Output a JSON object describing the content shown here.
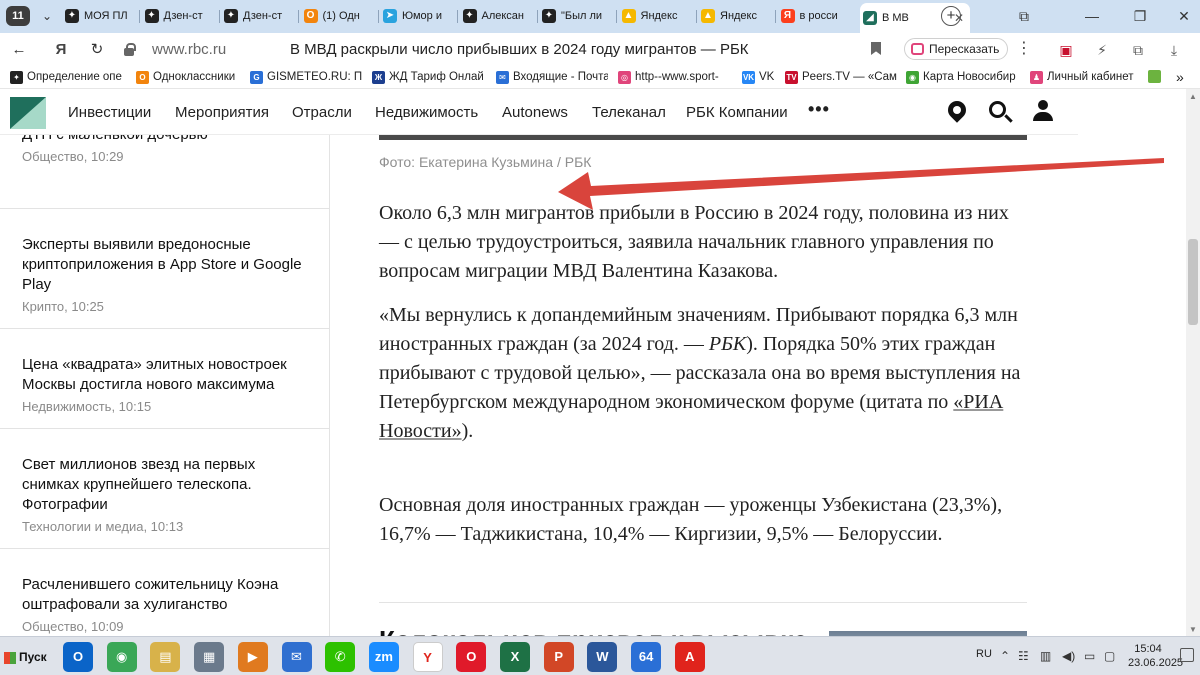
{
  "browser": {
    "tab_count": "11",
    "tabs": [
      {
        "label": "МОЯ ПЛ",
        "icon": "dzen-icon",
        "color": "#222222"
      },
      {
        "label": "Дзен-ст",
        "icon": "dzen-icon",
        "color": "#222222"
      },
      {
        "label": "Дзен-ст",
        "icon": "dzen-icon",
        "color": "#222222"
      },
      {
        "label": "(1) Одн",
        "icon": "odnoklassniki-icon",
        "color": "#f2840d"
      },
      {
        "label": "Юмор и",
        "icon": "telegram-icon",
        "color": "#2aa3de"
      },
      {
        "label": "Алексан",
        "icon": "dzen-icon",
        "color": "#222222"
      },
      {
        "label": "\"Был ли",
        "icon": "dzen-icon",
        "color": "#222222"
      },
      {
        "label": "Яндекс",
        "icon": "yandex-images-icon",
        "color": "#f5b800"
      },
      {
        "label": "Яндекс",
        "icon": "yandex-images-icon",
        "color": "#f5b800"
      },
      {
        "label": "в росси",
        "icon": "yandex-icon",
        "color": "#fc3f1d"
      },
      {
        "label": "В МВ",
        "icon": "rbc-icon",
        "color": "#1f6f5c",
        "active": true
      }
    ],
    "address": {
      "domain": "www.rbc.ru",
      "page_title": "В МВД раскрыли число прибывших в 2024 году мигрантов — РБК"
    },
    "retell_label": "Пересказать",
    "bookmarks": [
      {
        "label": "Определение опе",
        "icon": "dzen-icon",
        "color": "#222222"
      },
      {
        "label": "Одноклассники",
        "icon": "odnoklassniki-icon",
        "color": "#f2840d"
      },
      {
        "label": "GISMETEO.RU: По",
        "icon": "gismeteo-icon",
        "color": "#2a6fd6"
      },
      {
        "label": "ЖД Тариф Онлай",
        "icon": "rzd-icon",
        "color": "#1d3f8f"
      },
      {
        "label": "Входящие - Почта",
        "icon": "mail-icon",
        "color": "#2a6fd6"
      },
      {
        "label": "http--www.sport-",
        "icon": "sport-icon",
        "color": "#e0457b"
      },
      {
        "label": "VK",
        "icon": "vk-icon",
        "color": "#2787f5"
      },
      {
        "label": "Peers.TV — «Самы",
        "icon": "peerstv-icon",
        "color": "#c8102e"
      },
      {
        "label": "Карта Новосибир",
        "icon": "map-icon",
        "color": "#3fa535"
      },
      {
        "label": "Личный кабинет",
        "icon": "account-icon",
        "color": "#e0457b"
      }
    ]
  },
  "rbc": {
    "nav": [
      "Инвестиции",
      "Мероприятия",
      "Отрасли",
      "Недвижимость",
      "Autonews",
      "Телеканал",
      "РБК Компании"
    ],
    "more": "•••"
  },
  "sidebar": [
    {
      "title": "Челябинская журналистка погибла в ДТП с маленькой дочерью",
      "meta": "Общество, 10:29"
    },
    {
      "title": "Эксперты выявили вредоносные криптоприложения в App Store и Google Play",
      "meta": "Крипто, 10:25"
    },
    {
      "title": "Цена «квадрата» элитных новостроек Москвы достигла нового максимума",
      "meta": "Недвижимость, 10:15"
    },
    {
      "title": "Свет миллионов звезд на первых снимках крупнейшего телескопа. Фотографии",
      "meta": "Технологии и медиа, 10:13"
    },
    {
      "title": "Расчленившего сожительницу Коэна оштрафовали за хулиганство",
      "meta": "Общество, 10:09"
    }
  ],
  "article": {
    "caption": "Фото: Екатерина Кузьмина / РБК",
    "p1": "Около 6,3 млн мигрантов прибыли в Россию в 2024 году, половина из них — с целью трудоустроиться, заявила начальник главного управления по вопросам миграции МВД Валентина Казакова.",
    "p2_a": "«Мы вернулись к допандемийным значениям. Прибывают порядка 6,3 млн иностранных граждан (за 2024 год. — ",
    "p2_em": "РБК",
    "p2_b": "). Порядка 50% этих граждан прибывают с трудовой целью», — рассказала она во время выступления на Петербургском международном экономическом форуме (цитата по ",
    "p2_link": "«РИА Новости»",
    "p2_c": ").",
    "p3": "Основная доля иностранных граждан — уроженцы Узбекистана (23,3%), 16,7% — Таджикистана, 10,4% — Киргизии, 9,5% — Белоруссии.",
    "next_headline": "Колокольцев призвал к вызывке"
  },
  "taskbar": {
    "start": "Пуск",
    "lang": "RU",
    "time": "15:04",
    "date": "23.06.2025",
    "apps": [
      {
        "name": "outlook-icon",
        "glyph": "O",
        "color": "#0a64c8"
      },
      {
        "name": "chrome-icon",
        "glyph": "◉",
        "color": "#3aa757"
      },
      {
        "name": "file-manager-icon",
        "glyph": "▤",
        "color": "#d8b24a"
      },
      {
        "name": "calculator-icon",
        "glyph": "▦",
        "color": "#6b7a8c"
      },
      {
        "name": "media-player-icon",
        "glyph": "▶",
        "color": "#e07a1f"
      },
      {
        "name": "mail-icon",
        "glyph": "✉",
        "color": "#2f6fd0"
      },
      {
        "name": "wechat-icon",
        "glyph": "✆",
        "color": "#2dc100"
      },
      {
        "name": "zoom-icon",
        "glyph": "zm",
        "color": "#1a8cff"
      },
      {
        "name": "yandex-browser-icon",
        "glyph": "Y",
        "color": "#ffffff"
      },
      {
        "name": "opera-icon",
        "glyph": "O",
        "color": "#e01a2a"
      },
      {
        "name": "excel-icon",
        "glyph": "X",
        "color": "#1e7145"
      },
      {
        "name": "powerpoint-icon",
        "glyph": "P",
        "color": "#d24726"
      },
      {
        "name": "word-icon",
        "glyph": "W",
        "color": "#2b579a"
      },
      {
        "name": "win64-icon",
        "glyph": "64",
        "color": "#2a6fd6"
      },
      {
        "name": "acrobat-icon",
        "glyph": "A",
        "color": "#e0241c"
      }
    ]
  }
}
